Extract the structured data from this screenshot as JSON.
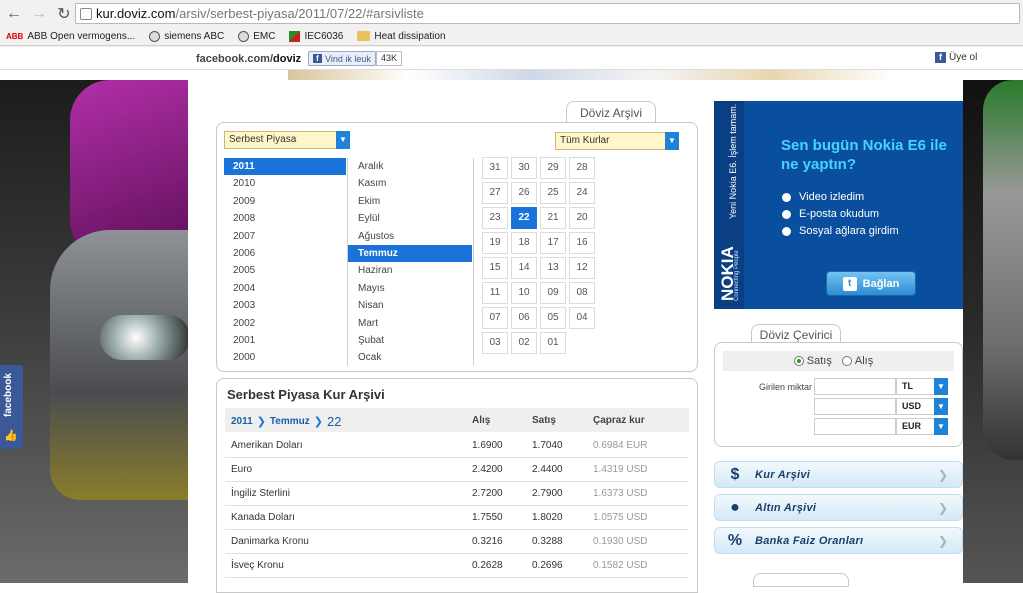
{
  "browser": {
    "url_domain": "kur.doviz.com",
    "url_path": "/arsiv/serbest-piyasa/2011/07/22/#arsivliste",
    "bookmarks": [
      {
        "icon": "abb-icon",
        "label": "ABB Open vermogens..."
      },
      {
        "icon": "globe-icon",
        "label": "siemens ABC"
      },
      {
        "icon": "globe-icon",
        "label": "EMC"
      },
      {
        "icon": "iec-icon",
        "label": "IEC6036"
      },
      {
        "icon": "folder-icon",
        "label": "Heat dissipation"
      }
    ]
  },
  "fbbar": {
    "domain_prefix": "facebook.com/",
    "domain_bold": "doviz",
    "like_label": "Vind ik leuk",
    "like_count": "43K",
    "join_label": "Üye ol"
  },
  "fbside": {
    "label": "facebook"
  },
  "archive": {
    "tab_title": "Döviz Arşivi",
    "market_select": "Serbest Piyasa",
    "rate_select": "Tüm Kurlar",
    "years": [
      "2011",
      "2010",
      "2009",
      "2008",
      "2007",
      "2006",
      "2005",
      "2004",
      "2003",
      "2002",
      "2001",
      "2000"
    ],
    "selected_year": "2011",
    "months": [
      "Aralık",
      "Kasım",
      "Ekim",
      "Eylül",
      "Ağustos",
      "Temmuz",
      "Haziran",
      "Mayıs",
      "Nisan",
      "Mart",
      "Şubat",
      "Ocak"
    ],
    "selected_month": "Temmuz",
    "days": [
      "31",
      "30",
      "29",
      "28",
      "27",
      "26",
      "25",
      "24",
      "23",
      "22",
      "21",
      "20",
      "19",
      "18",
      "17",
      "16",
      "15",
      "14",
      "13",
      "12",
      "11",
      "10",
      "09",
      "08",
      "07",
      "06",
      "05",
      "04",
      "03",
      "02",
      "01"
    ],
    "selected_day": "22"
  },
  "rates": {
    "title": "Serbest Piyasa Kur Arşivi",
    "crumb_year": "2011",
    "crumb_month": "Temmuz",
    "crumb_day": "22",
    "col_buy": "Alış",
    "col_sell": "Satış",
    "col_cross": "Çapraz kur",
    "rows": [
      {
        "name": "Amerikan Doları",
        "buy": "1.6900",
        "sell": "1.7040",
        "cross": "0.6984 EUR"
      },
      {
        "name": "Euro",
        "buy": "2.4200",
        "sell": "2.4400",
        "cross": "1.4319 USD"
      },
      {
        "name": "İngiliz Sterlini",
        "buy": "2.7200",
        "sell": "2.7900",
        "cross": "1.6373 USD"
      },
      {
        "name": "Kanada Doları",
        "buy": "1.7550",
        "sell": "1.8020",
        "cross": "1.0575 USD"
      },
      {
        "name": "Danimarka Kronu",
        "buy": "0.3216",
        "sell": "0.3288",
        "cross": "0.1930 USD"
      },
      {
        "name": "İsveç Kronu",
        "buy": "0.2628",
        "sell": "0.2696",
        "cross": "0.1582 USD"
      }
    ]
  },
  "ad": {
    "brand": "NOKIA",
    "brand_sub": "Connecting People",
    "vertical_text": "Yeni Nokia E6. İşlem tamam.",
    "headline": "Sen bugün Nokia E6 ile ne yaptın?",
    "options": [
      "Video izledim",
      "E-posta okudum",
      "Sosyal ağlara girdim"
    ],
    "button": "Bağlan"
  },
  "converter": {
    "tab_title": "Döviz Çevirici",
    "radio_sell": "Satış",
    "radio_buy": "Alış",
    "amount_label": "Girilen miktar",
    "currencies": [
      "TL",
      "USD",
      "EUR"
    ]
  },
  "links": [
    {
      "icon": "coins-icon",
      "label": "Kur Arşivi"
    },
    {
      "icon": "gold-icon",
      "label": "Altın Arşivi"
    },
    {
      "icon": "percent-icon",
      "label": "Banka Faiz Oranları"
    }
  ]
}
